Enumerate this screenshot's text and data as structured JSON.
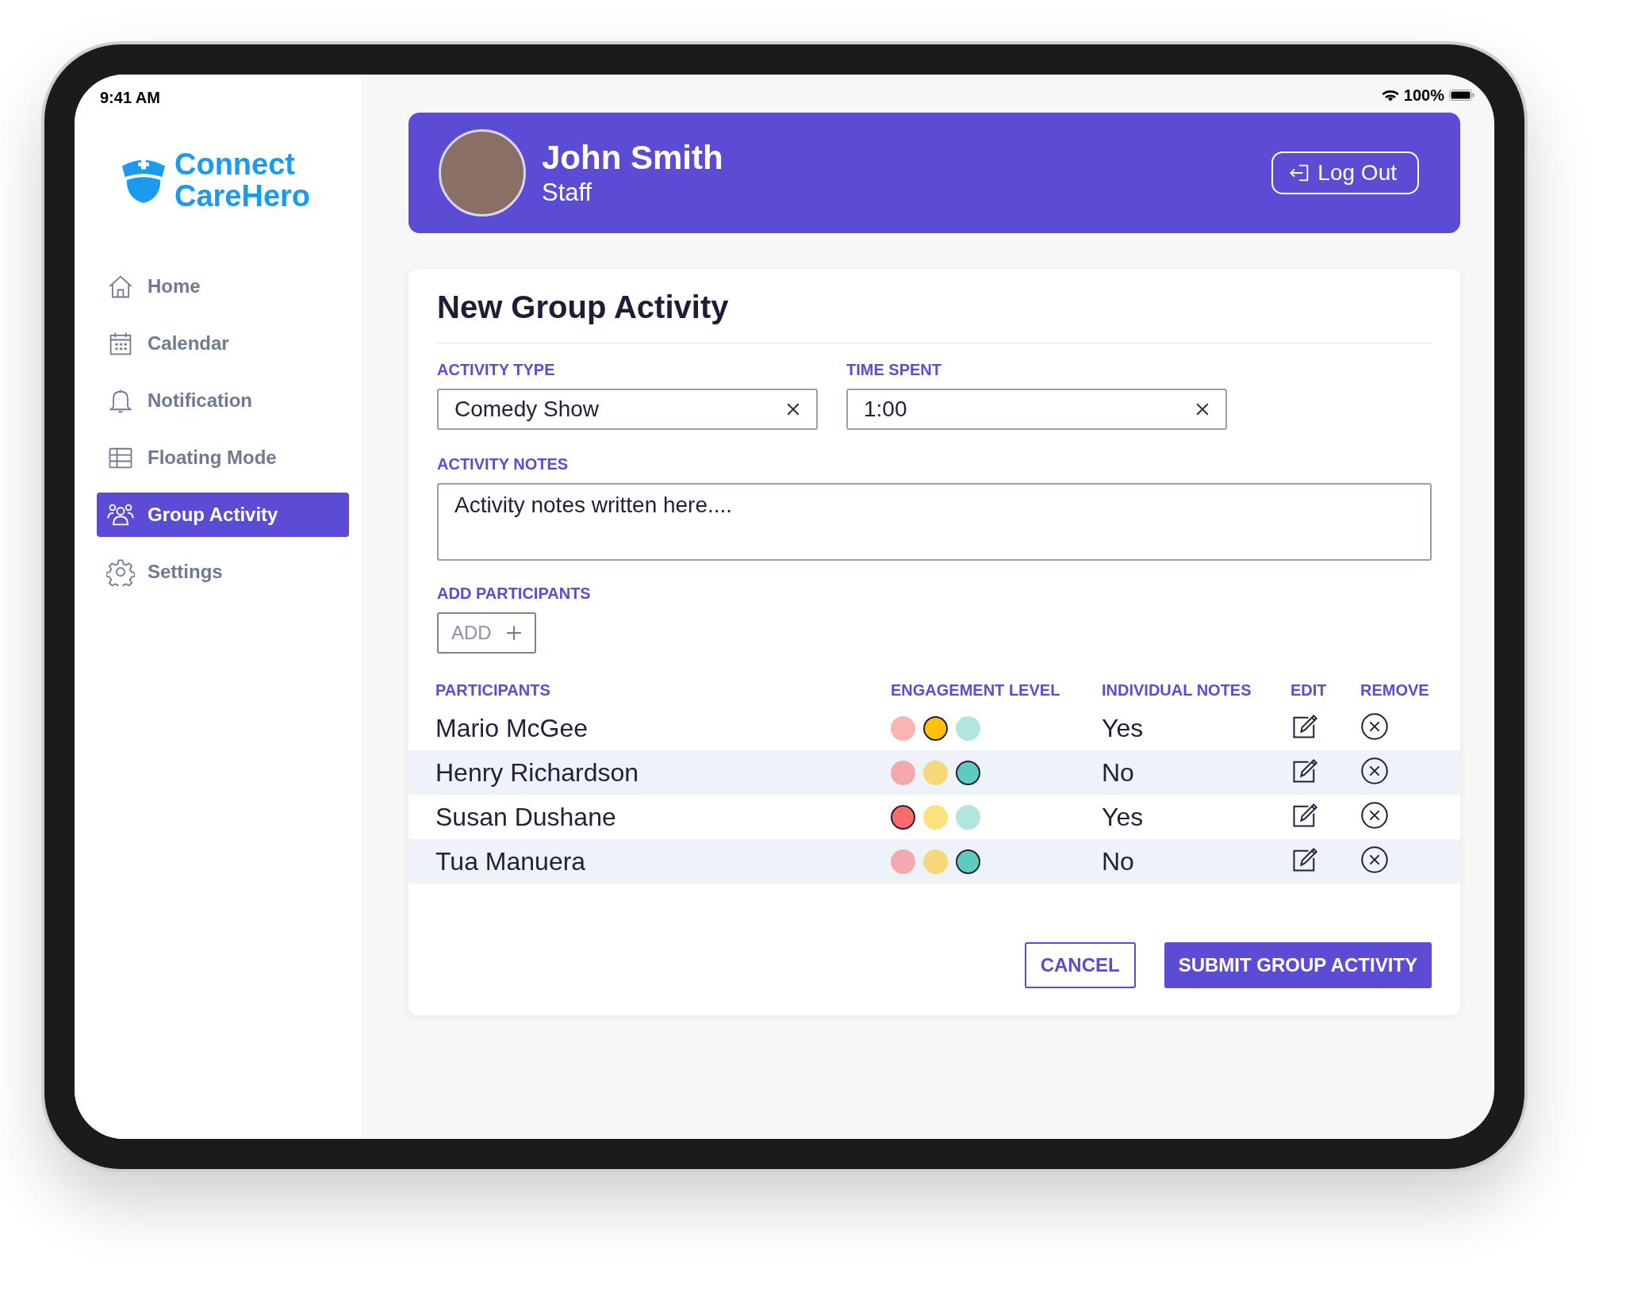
{
  "status_bar": {
    "time": "9:41 AM",
    "battery": "100%"
  },
  "logo": {
    "line_1": "Connect",
    "line_2": "CareHero"
  },
  "sidebar": {
    "items": [
      {
        "label": "Home",
        "kind": "home",
        "selected": false
      },
      {
        "label": "Calendar",
        "kind": "calendar",
        "selected": false
      },
      {
        "label": "Notification",
        "kind": "bell",
        "selected": false
      },
      {
        "label": "Floating Mode",
        "kind": "table",
        "selected": false
      },
      {
        "label": "Group Activity",
        "kind": "people",
        "selected": true
      },
      {
        "label": "Settings",
        "kind": "gear",
        "selected": false
      }
    ]
  },
  "header": {
    "name": "John Smith",
    "role": "Staff",
    "logout": "Log Out"
  },
  "form": {
    "title": "New Group Activity",
    "activity_type": {
      "label": "ACTIVITY TYPE",
      "value": "Comedy Show"
    },
    "time_spent": {
      "label": "TIME SPENT",
      "value": "1:00"
    },
    "notes": {
      "label": "ACTIVITY NOTES",
      "value": "Activity notes written here...."
    },
    "add_participants": {
      "label": "ADD PARTICIPANTS",
      "button": "ADD"
    },
    "table": {
      "columns": [
        "PARTICIPANTS",
        "ENGAGEMENT LEVEL",
        "INDIVIDUAL NOTES",
        "EDIT",
        "REMOVE"
      ],
      "rows": [
        {
          "name": "Mario McGee",
          "notes": "Yes",
          "levels": [
            {
              "color": "#fbb3b3",
              "selected": false
            },
            {
              "color": "#ffc107",
              "selected": true
            },
            {
              "color": "#b1e5e0",
              "selected": false
            }
          ]
        },
        {
          "name": "Henry Richardson",
          "notes": "No",
          "levels": [
            {
              "color": "#f5a9ae",
              "selected": false
            },
            {
              "color": "#f5d87a",
              "selected": false
            },
            {
              "color": "#5ecbc1",
              "selected": true
            }
          ]
        },
        {
          "name": "Susan Dushane",
          "notes": "Yes",
          "levels": [
            {
              "color": "#ff6b6b",
              "selected": true
            },
            {
              "color": "#fde17c",
              "selected": false
            },
            {
              "color": "#b1e5e0",
              "selected": false
            }
          ]
        },
        {
          "name": "Tua Manuera",
          "notes": "No",
          "levels": [
            {
              "color": "#f5a9ae",
              "selected": false
            },
            {
              "color": "#f5d87a",
              "selected": false
            },
            {
              "color": "#5ecbc1",
              "selected": true
            }
          ]
        }
      ]
    },
    "buttons": {
      "cancel": "CANCEL",
      "submit": "SUBMIT GROUP ACTIVITY"
    }
  }
}
